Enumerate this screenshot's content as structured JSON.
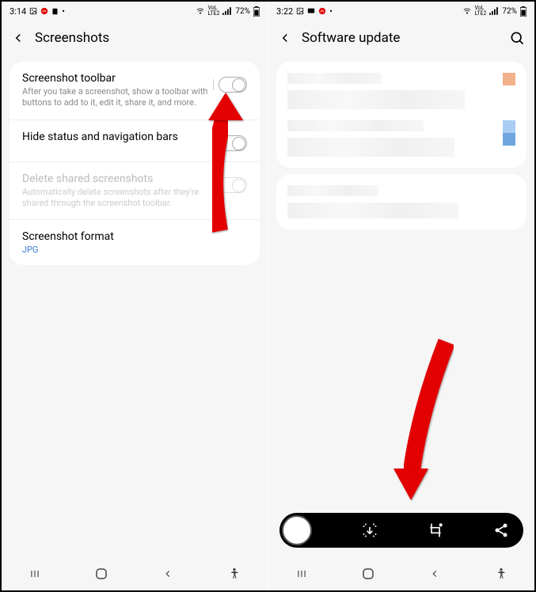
{
  "left": {
    "status": {
      "time": "3:14",
      "battery": "72%"
    },
    "header": {
      "title": "Screenshots"
    },
    "settings": [
      {
        "title": "Screenshot toolbar",
        "desc": "After you take a screenshot, show a toolbar with buttons to add to it, edit it, share it, and more."
      },
      {
        "title": "Hide status and navigation bars"
      },
      {
        "title": "Delete shared screenshots",
        "desc": "Automatically delete screenshots after they're shared through the screenshot toolbar."
      },
      {
        "title": "Screenshot format",
        "sub": "JPG"
      }
    ]
  },
  "right": {
    "status": {
      "time": "3:22",
      "battery": "72%"
    },
    "header": {
      "title": "Software update"
    }
  }
}
